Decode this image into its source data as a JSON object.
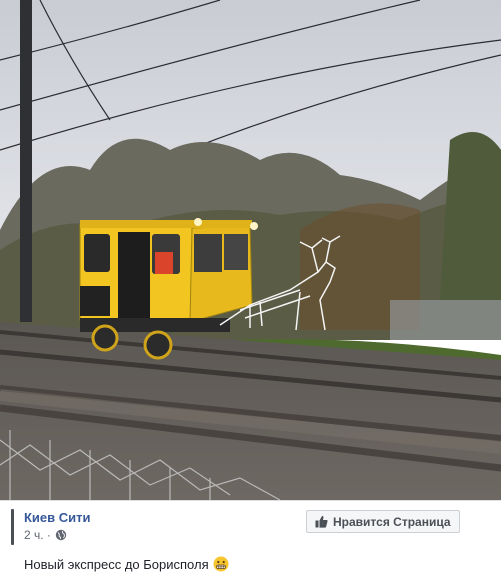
{
  "post": {
    "page_name": "Киев Сити",
    "time": "2 ч. ·",
    "like_button_label": "Нравится Страница",
    "caption": "Новый экспресс до Борисполя",
    "icons": {
      "privacy": "globe-icon",
      "like": "thumbs-up-icon",
      "emoji": "grimacing-face-icon"
    }
  },
  "colors": {
    "link": "#365899",
    "text": "#1d2129",
    "muted": "#616770",
    "vehicle": "#f2c521"
  }
}
